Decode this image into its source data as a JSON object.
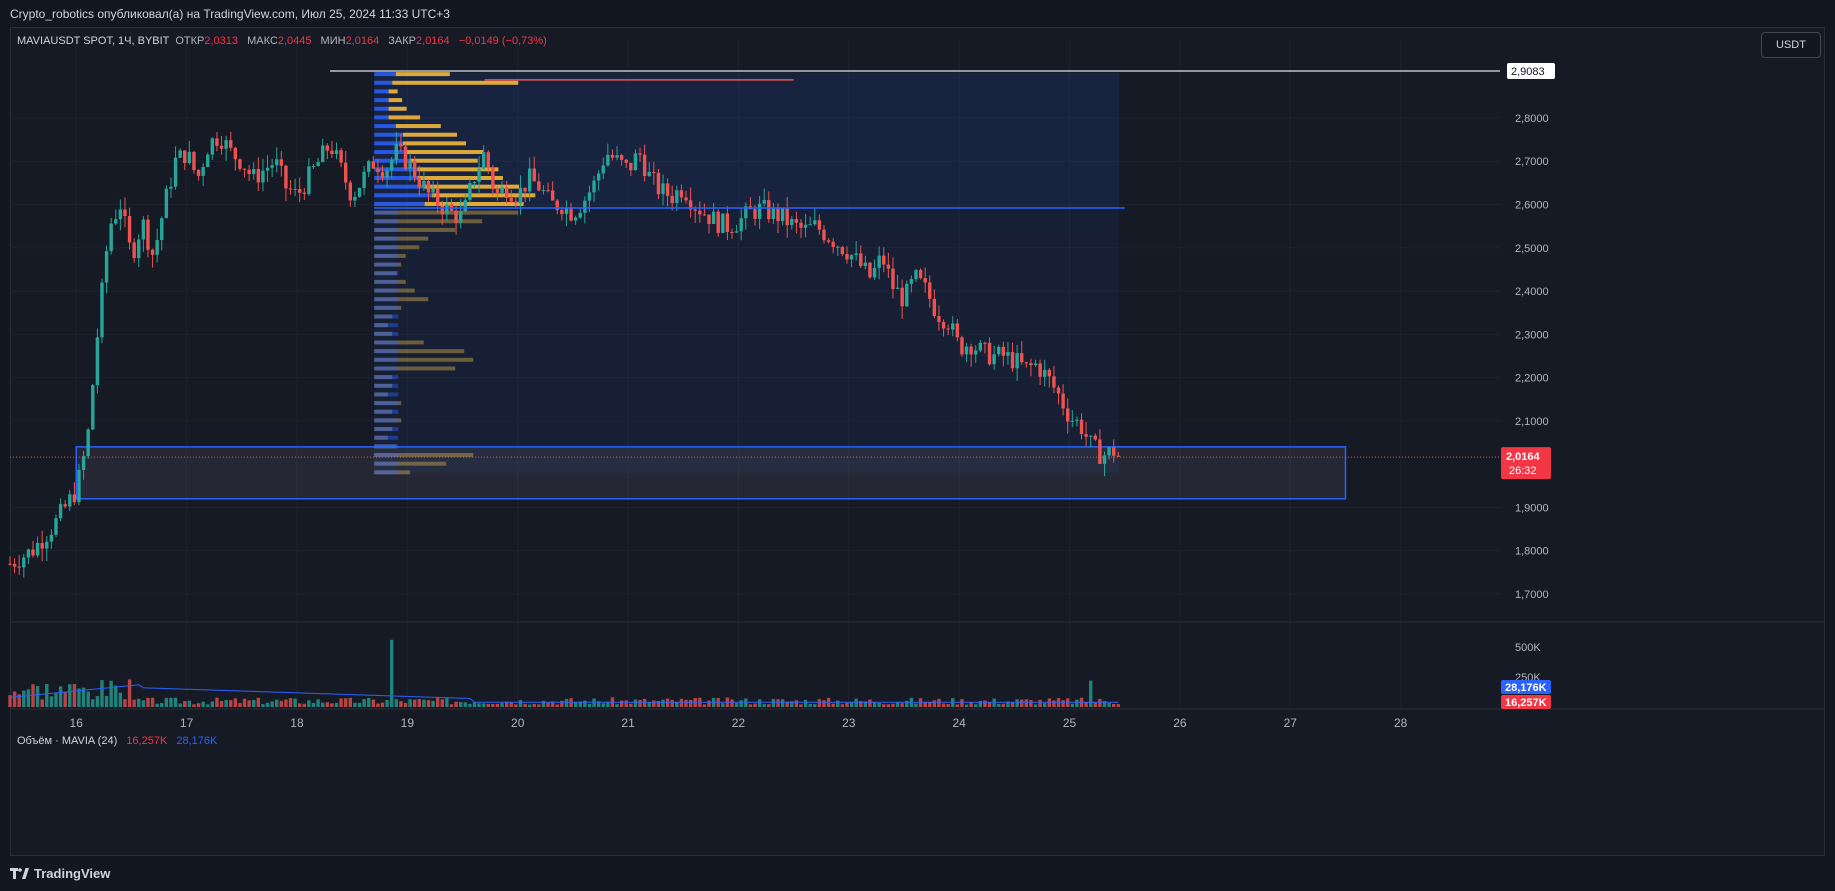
{
  "header": {
    "publisher_line": "Crypto_robotics опубликовал(а) на TradingView.com, Июл 25, 2024 11:33 UTC+3"
  },
  "legend": {
    "symbol": "MAVIAUSDT SPOT, 1Ч, BYBIT",
    "open_label": "ОТКР",
    "open": "2,0313",
    "high_label": "МАКС",
    "high": "2,0445",
    "low_label": "МИН",
    "low": "2,0164",
    "close_label": "ЗАКР",
    "close": "2,0164",
    "change": "−0,0149 (−0,73%)"
  },
  "currency_button": "USDT",
  "volume_legend": {
    "label": "Объём · MAVIA (24)",
    "v1": "16,257K",
    "v2": "28,176K"
  },
  "footer": {
    "brand": "TradingView"
  },
  "colors": {
    "up": "#26a69a",
    "down": "#ef5350",
    "background": "#131722",
    "grid": "#1e222d",
    "zone": "#2962ff",
    "profile_blue": "#2962ff",
    "profile_yellow": "#e8b23a"
  },
  "chart_data": {
    "type": "candlestick",
    "price_axis": {
      "ticks": [
        "2,8000",
        "2,7000",
        "2,6000",
        "2,5000",
        "2,4000",
        "2,3000",
        "2,2000",
        "2,1000",
        "1,9000",
        "1,8000",
        "1,7000"
      ],
      "tick_values": [
        2.8,
        2.7,
        2.6,
        2.5,
        2.4,
        2.3,
        2.2,
        2.1,
        1.9,
        1.8,
        1.7
      ],
      "ylim": [
        1.64,
        2.98
      ],
      "top_level_label": "2,9083",
      "top_level_value": 2.9083,
      "last_price_label": "2,0164",
      "last_price_value": 2.0164,
      "countdown": "26:32"
    },
    "volume_axis": {
      "ticks": [
        "500K",
        "250K"
      ],
      "tick_values": [
        500000,
        250000
      ],
      "current_labels": [
        "28,176K",
        "16,257K"
      ]
    },
    "x_axis": {
      "labels": [
        "16",
        "17",
        "18",
        "19",
        "20",
        "21",
        "22",
        "23",
        "24",
        "25",
        "26",
        "27",
        "28"
      ],
      "days": [
        16,
        17,
        18,
        19,
        20,
        21,
        22,
        23,
        24,
        25,
        26,
        27,
        28
      ],
      "xlim": [
        15.4,
        28.9
      ]
    },
    "lines": [
      {
        "name": "top",
        "value": 2.9083,
        "x0": 18.3,
        "x1": 28.9
      },
      {
        "name": "red",
        "value": 2.888,
        "x0": 19.7,
        "x1": 22.5
      },
      {
        "name": "blue",
        "value": 2.592,
        "x0": 18.7,
        "x1": 25.5
      }
    ],
    "zone": {
      "x0": 16.0,
      "x1": 27.5,
      "y_top": 2.04,
      "y_bottom": 1.92
    },
    "price_path": [
      [
        15.4,
        1.77
      ],
      [
        15.6,
        1.8
      ],
      [
        15.8,
        1.86
      ],
      [
        16.0,
        1.94
      ],
      [
        16.1,
        2.05
      ],
      [
        16.2,
        2.32
      ],
      [
        16.3,
        2.55
      ],
      [
        16.4,
        2.6
      ],
      [
        16.5,
        2.48
      ],
      [
        16.6,
        2.56
      ],
      [
        16.7,
        2.48
      ],
      [
        16.8,
        2.6
      ],
      [
        16.9,
        2.7
      ],
      [
        17.0,
        2.72
      ],
      [
        17.1,
        2.66
      ],
      [
        17.2,
        2.74
      ],
      [
        17.3,
        2.76
      ],
      [
        17.4,
        2.72
      ],
      [
        17.5,
        2.7
      ],
      [
        17.6,
        2.66
      ],
      [
        17.7,
        2.68
      ],
      [
        17.8,
        2.7
      ],
      [
        17.9,
        2.64
      ],
      [
        18.0,
        2.62
      ],
      [
        18.1,
        2.66
      ],
      [
        18.2,
        2.7
      ],
      [
        18.3,
        2.74
      ],
      [
        18.4,
        2.68
      ],
      [
        18.5,
        2.62
      ],
      [
        18.6,
        2.66
      ],
      [
        18.7,
        2.7
      ],
      [
        18.8,
        2.68
      ],
      [
        18.9,
        2.72
      ],
      [
        19.0,
        2.7
      ],
      [
        19.1,
        2.66
      ],
      [
        19.2,
        2.62
      ],
      [
        19.3,
        2.6
      ],
      [
        19.4,
        2.58
      ],
      [
        19.5,
        2.57
      ],
      [
        19.6,
        2.66
      ],
      [
        19.7,
        2.72
      ],
      [
        19.8,
        2.62
      ],
      [
        19.9,
        2.64
      ],
      [
        20.0,
        2.62
      ],
      [
        20.1,
        2.66
      ],
      [
        20.2,
        2.64
      ],
      [
        20.3,
        2.6
      ],
      [
        20.4,
        2.6
      ],
      [
        20.5,
        2.58
      ],
      [
        20.6,
        2.61
      ],
      [
        20.7,
        2.65
      ],
      [
        20.8,
        2.72
      ],
      [
        20.9,
        2.7
      ],
      [
        21.0,
        2.68
      ],
      [
        21.1,
        2.72
      ],
      [
        21.2,
        2.66
      ],
      [
        21.3,
        2.63
      ],
      [
        21.4,
        2.62
      ],
      [
        21.5,
        2.64
      ],
      [
        21.6,
        2.6
      ],
      [
        21.7,
        2.58
      ],
      [
        21.8,
        2.56
      ],
      [
        21.9,
        2.55
      ],
      [
        22.0,
        2.56
      ],
      [
        22.1,
        2.58
      ],
      [
        22.2,
        2.59
      ],
      [
        22.3,
        2.58
      ],
      [
        22.4,
        2.57
      ],
      [
        22.5,
        2.55
      ],
      [
        22.6,
        2.54
      ],
      [
        22.7,
        2.55
      ],
      [
        22.8,
        2.53
      ],
      [
        22.9,
        2.51
      ],
      [
        23.0,
        2.49
      ],
      [
        23.1,
        2.46
      ],
      [
        23.2,
        2.43
      ],
      [
        23.3,
        2.48
      ],
      [
        23.4,
        2.41
      ],
      [
        23.5,
        2.38
      ],
      [
        23.6,
        2.43
      ],
      [
        23.7,
        2.4
      ],
      [
        23.8,
        2.35
      ],
      [
        23.9,
        2.33
      ],
      [
        24.0,
        2.27
      ],
      [
        24.1,
        2.28
      ],
      [
        24.2,
        2.26
      ],
      [
        24.3,
        2.25
      ],
      [
        24.4,
        2.25
      ],
      [
        24.5,
        2.24
      ],
      [
        24.6,
        2.22
      ],
      [
        24.7,
        2.23
      ],
      [
        24.8,
        2.2
      ],
      [
        24.9,
        2.16
      ],
      [
        25.0,
        2.11
      ],
      [
        25.1,
        2.09
      ],
      [
        25.2,
        2.04
      ],
      [
        25.3,
        2.02
      ],
      [
        25.4,
        2.03
      ],
      [
        25.45,
        2.0164
      ]
    ],
    "volume_profile": {
      "x_start": 18.7,
      "rows": [
        {
          "y": 2.9,
          "b": 0.3,
          "w": 0.6
        },
        {
          "y": 2.88,
          "b": 0.25,
          "w": 1.4
        },
        {
          "y": 2.86,
          "b": 0.2,
          "w": 0.1
        },
        {
          "y": 2.84,
          "b": 0.2,
          "w": 0.15
        },
        {
          "y": 2.82,
          "b": 0.2,
          "w": 0.2
        },
        {
          "y": 2.8,
          "b": 0.2,
          "w": 0.35
        },
        {
          "y": 2.78,
          "b": 0.3,
          "w": 0.5
        },
        {
          "y": 2.76,
          "b": 0.4,
          "w": 0.6
        },
        {
          "y": 2.74,
          "b": 0.4,
          "w": 0.7
        },
        {
          "y": 2.72,
          "b": 0.45,
          "w": 0.85
        },
        {
          "y": 2.7,
          "b": 0.5,
          "w": 0.75
        },
        {
          "y": 2.68,
          "b": 0.6,
          "w": 0.9
        },
        {
          "y": 2.66,
          "b": 0.6,
          "w": 0.95
        },
        {
          "y": 2.64,
          "b": 0.7,
          "w": 1.05
        },
        {
          "y": 2.62,
          "b": 0.8,
          "w": 1.15
        },
        {
          "y": 2.6,
          "b": 0.7,
          "w": 1.1
        },
        {
          "y": 2.58,
          "b": 0.0,
          "w": 1.6
        },
        {
          "y": 2.56,
          "b": 0.0,
          "w": 1.2
        },
        {
          "y": 2.54,
          "b": 0.0,
          "w": 0.9
        },
        {
          "y": 2.52,
          "b": 0.0,
          "w": 0.6
        },
        {
          "y": 2.5,
          "b": 0.0,
          "w": 0.5
        },
        {
          "y": 2.48,
          "b": 0.0,
          "w": 0.35
        },
        {
          "y": 2.46,
          "b": 0.0,
          "w": 0.3
        },
        {
          "y": 2.44,
          "b": 0.0,
          "w": 0.25
        },
        {
          "y": 2.42,
          "b": 0.0,
          "w": 0.35
        },
        {
          "y": 2.4,
          "b": 0.0,
          "w": 0.45
        },
        {
          "y": 2.38,
          "b": 0.0,
          "w": 0.6
        },
        {
          "y": 2.36,
          "b": 0.0,
          "w": 0.3
        },
        {
          "y": 2.34,
          "b": 0.0,
          "w": 0.2
        },
        {
          "y": 2.32,
          "b": 0.0,
          "w": 0.15
        },
        {
          "y": 2.3,
          "b": 0.0,
          "w": 0.2
        },
        {
          "y": 2.28,
          "b": 0.0,
          "w": 0.55
        },
        {
          "y": 2.26,
          "b": 0.0,
          "w": 1.0
        },
        {
          "y": 2.24,
          "b": 0.0,
          "w": 1.1
        },
        {
          "y": 2.22,
          "b": 0.0,
          "w": 0.9
        },
        {
          "y": 2.2,
          "b": 0.0,
          "w": 0.2
        },
        {
          "y": 2.18,
          "b": 0.0,
          "w": 0.2
        },
        {
          "y": 2.16,
          "b": 0.0,
          "w": 0.15
        },
        {
          "y": 2.14,
          "b": 0.0,
          "w": 0.3
        },
        {
          "y": 2.12,
          "b": 0.0,
          "w": 0.2
        },
        {
          "y": 2.1,
          "b": 0.0,
          "w": 0.3
        },
        {
          "y": 2.08,
          "b": 0.0,
          "w": 0.2
        },
        {
          "y": 2.06,
          "b": 0.0,
          "w": 0.15
        },
        {
          "y": 2.04,
          "b": 0.0,
          "w": 0.25
        },
        {
          "y": 2.02,
          "b": 0.0,
          "w": 1.1
        },
        {
          "y": 2.0,
          "b": 0.0,
          "w": 0.8
        },
        {
          "y": 1.98,
          "b": 0.0,
          "w": 0.4
        }
      ]
    },
    "volume_bars_note": "hourly volume bars, notable spike near Jul 18 20:00 ≈ 560K"
  }
}
